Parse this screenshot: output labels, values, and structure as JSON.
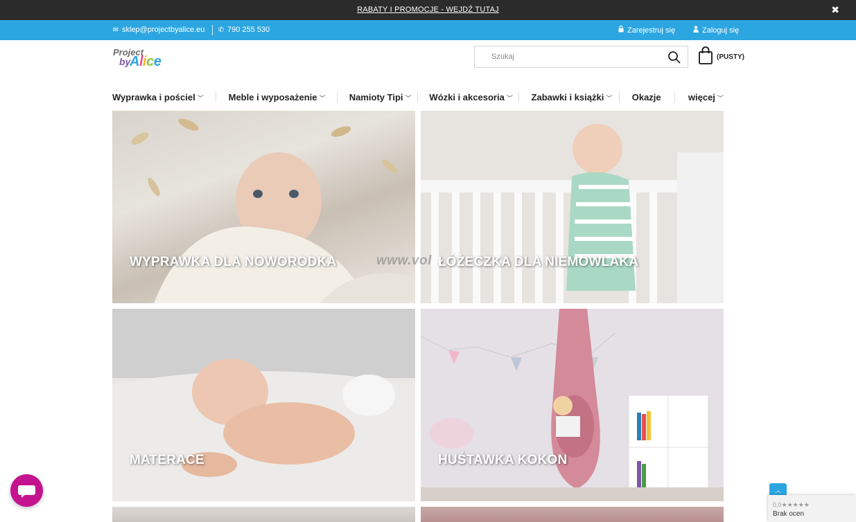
{
  "promo": {
    "text": "RABATY I PROMOCJE - WEJDŹ TUTAJ",
    "close_icon": "close-icon"
  },
  "contact": {
    "email": "sklep@projectbyalice.eu",
    "phone": "790 255 530",
    "register": "Zarejestruj się",
    "login": "Zaloguj się"
  },
  "logo": {
    "line1": "Project",
    "line2": "by",
    "line3_letters": [
      "A",
      "l",
      "i",
      "c",
      "e"
    ]
  },
  "search": {
    "placeholder": "Szukaj"
  },
  "cart": {
    "label": "(PUSTY)"
  },
  "nav": [
    {
      "label": "Wyprawka i pościel"
    },
    {
      "label": "Meble i wyposażenie"
    },
    {
      "label": "Namioty Tipi"
    },
    {
      "label": "Wózki i akcesoria"
    },
    {
      "label": "Zabawki i książki"
    },
    {
      "label": "Okazje"
    },
    {
      "label": "więcej"
    }
  ],
  "tiles": [
    {
      "caption": "WYPRAWKA DLA NOWORODKA"
    },
    {
      "caption": "ŁÓŻECZKA DLA NIEMOWLAKA"
    },
    {
      "caption": "MATERACE"
    },
    {
      "caption": "HUŚTAWKA KOKON"
    }
  ],
  "watermark": "www.vol",
  "reviews_badge": {
    "rating": "0,0",
    "label": "Brak ocen"
  },
  "colors": {
    "accent": "#2ca6e0",
    "promo_bg": "#2b2b2b",
    "chat": "#c4138f"
  }
}
